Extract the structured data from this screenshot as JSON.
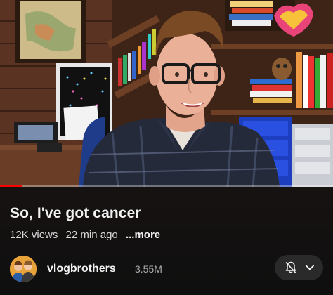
{
  "video": {
    "title": "So, I've got cancer",
    "views": "12K views",
    "age": "22 min ago",
    "more_label": "...more",
    "progress_fraction": 0.065
  },
  "channel": {
    "name": "vlogbrothers",
    "subscribers": "3.55M"
  },
  "subscription": {
    "bell_icon": "bell-off-icon",
    "dropdown_icon": "chevron-down-icon"
  },
  "colors": {
    "background": "#0f0f0f",
    "progress": "#ff0000",
    "pill": "#2a2a2a"
  }
}
